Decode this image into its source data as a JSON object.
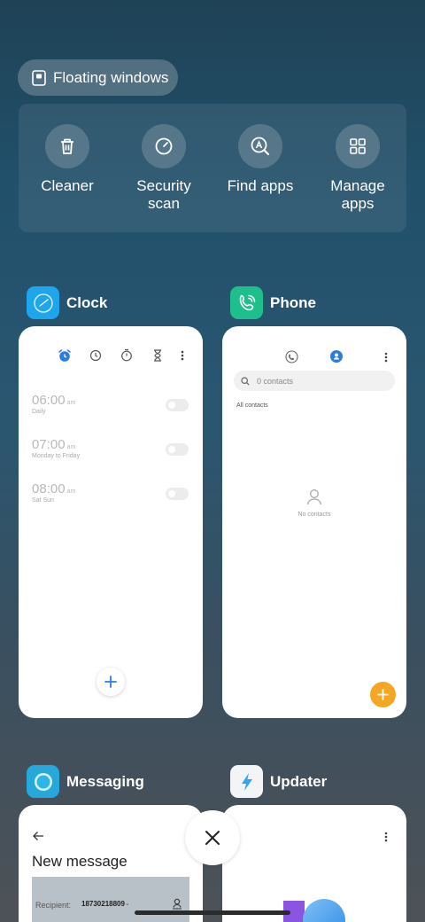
{
  "floating_windows": {
    "label": "Floating windows",
    "icon": "floating-window-icon"
  },
  "quick_actions": [
    {
      "label": "Cleaner",
      "icon": "trash-icon"
    },
    {
      "label": "Security\nscan",
      "icon": "gauge-icon"
    },
    {
      "label": "Find apps",
      "icon": "find-apps-icon"
    },
    {
      "label": "Manage\napps",
      "icon": "grid-icon"
    }
  ],
  "apps": {
    "clock": {
      "name": "Clock",
      "icon_color": "#1ea6ec",
      "alarms": [
        {
          "time": "06:00",
          "ampm": "am",
          "label": "Daily"
        },
        {
          "time": "07:00",
          "ampm": "am",
          "label": "Monday to Friday"
        },
        {
          "time": "08:00",
          "ampm": "am",
          "label": "Sat Sun"
        }
      ]
    },
    "phone": {
      "name": "Phone",
      "icon_color": "#1ebf8a",
      "search_placeholder": "0 contacts",
      "section": "All contacts",
      "empty": "No contacts",
      "fab_color": "#f5a623"
    },
    "messaging": {
      "name": "Messaging",
      "title": "New message",
      "recipient_label": "Recipient:",
      "recipient_value": "18730218809"
    },
    "updater": {
      "name": "Updater"
    }
  },
  "colors": {
    "accent_blue": "#2a7de1",
    "fab_orange": "#f5a623"
  }
}
